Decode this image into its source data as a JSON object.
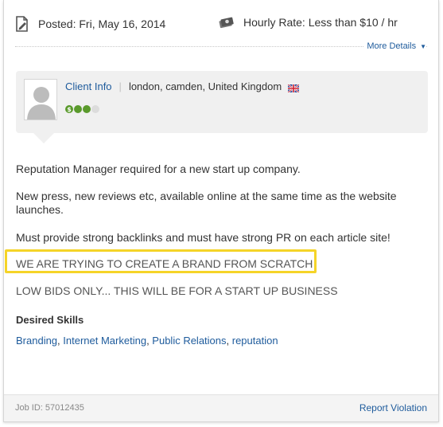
{
  "meta": {
    "posted": "Posted: Fri, May 16, 2014",
    "rate": "Hourly Rate: Less than $10 / hr",
    "more_details": "More Details",
    "posted_icon": "document-edit-icon",
    "rate_icon": "money-icon"
  },
  "client": {
    "info_label": "Client Info",
    "location": "london, camden, United Kingdom",
    "flag_icon": "uk-flag-icon",
    "rating_filled": 2,
    "rating_total": 3,
    "accent_color": "#5a9a2c"
  },
  "description": {
    "p1": "Reputation Manager required for a new start up company.",
    "p2": "New press, new reviews etc, available online at the same time as the website launches.",
    "p3": "Must provide strong backlinks and must have strong PR on each article site!",
    "p4": "WE ARE TRYING TO CREATE A BRAND FROM SCRATCH",
    "p5": "LOW BIDS ONLY... THIS WILL BE FOR A START UP BUSINESS"
  },
  "skills": {
    "heading": "Desired Skills",
    "items": [
      "Branding",
      "Internet Marketing",
      "Public Relations",
      "reputation"
    ],
    "separator": ", "
  },
  "footer": {
    "job_id": "Job ID: 57012435",
    "report": "Report Violation"
  },
  "colors": {
    "link": "#1e5b9c",
    "highlight": "#f5d428"
  }
}
